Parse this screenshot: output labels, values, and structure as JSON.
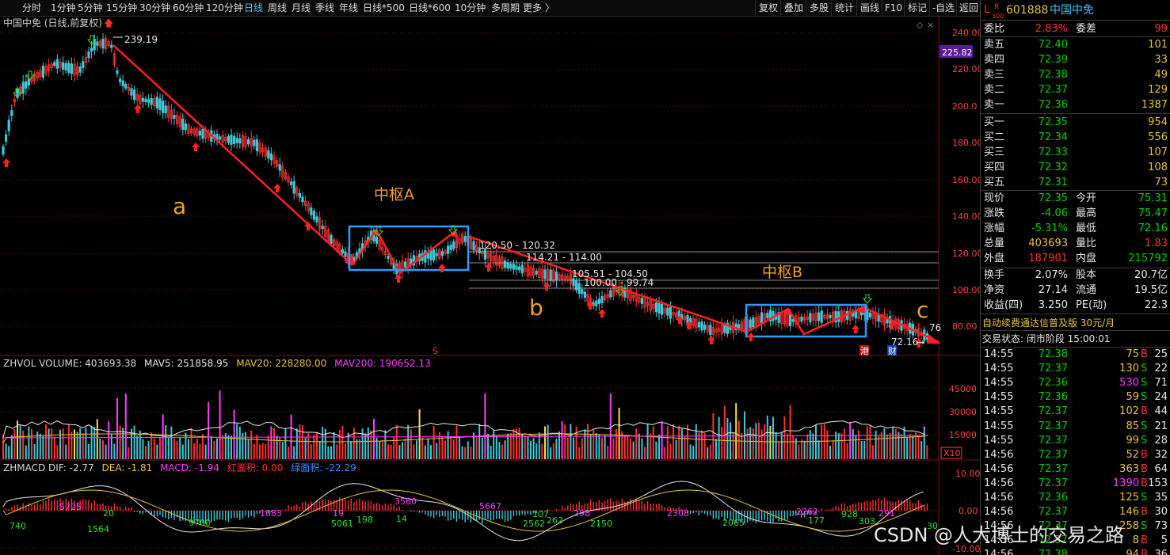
{
  "toolbar": {
    "periods": [
      "分时",
      "1分钟",
      "5分钟",
      "15分钟",
      "30分钟",
      "60分钟",
      "120分钟",
      "日线",
      "周线",
      "月线",
      "季线",
      "年线",
      "日线*500",
      "日线*600",
      "10分钟",
      "多周期",
      "更多 〉"
    ],
    "active": "日线",
    "right_buttons": [
      "复权",
      "叠加",
      "多股",
      "统计",
      "画线",
      "F10",
      "标记",
      "-自选",
      "返回"
    ]
  },
  "chart": {
    "title": "中国中免 (日线,前复权)",
    "price_axis": [
      "240.00",
      "220.00",
      "200.0",
      "180.00",
      "160.00",
      "140.00",
      "120.00",
      "100.00",
      "80.00"
    ],
    "current_price_label": "225.82",
    "high_label": "239.19",
    "low_label": "72.16",
    "last_label": "76",
    "annotations": {
      "a": "a",
      "b": "b",
      "c": "c",
      "zhongshu_a": "中枢A",
      "zhongshu_b": "中枢B"
    },
    "level_labels": [
      "120.50 - 120.32",
      "114.21 - 114.00",
      "105.51 - 104.50",
      "100.00 - 99.74"
    ],
    "markers": {
      "s": "S",
      "gang": "港",
      "cai": "财"
    },
    "volume": {
      "label": "ZHVOL VOLUME: 403693.38",
      "mav5": "MAV5: 251858.95",
      "mav20": "MAV20: 228280.00",
      "mav200": "MAV200: 190652.13",
      "axis": [
        "45000",
        "30000",
        "15000"
      ],
      "unit": "X10"
    },
    "macd": {
      "label": "ZHMACD DIF: -2.77",
      "dea": "DEA: -1.81",
      "macd": "MACD: -1.94",
      "red_area": "红面积: 0.00",
      "green_area": "绿面积: -22.29",
      "axis": [
        "10.00",
        "0.00",
        "-10.00"
      ],
      "bar_labels": [
        {
          "t": "740",
          "c": "g"
        },
        {
          "t": "5725",
          "c": "p"
        },
        {
          "t": "1564",
          "c": "g"
        },
        {
          "t": "20",
          "c": "g"
        },
        {
          "t": "9700",
          "c": "g"
        },
        {
          "t": "1083",
          "c": "p"
        },
        {
          "t": "19",
          "c": "p"
        },
        {
          "t": "5061",
          "c": "g"
        },
        {
          "t": "198",
          "c": "g"
        },
        {
          "t": "3560",
          "c": "p"
        },
        {
          "t": "14",
          "c": "g"
        },
        {
          "t": "5667",
          "c": "p"
        },
        {
          "t": "107",
          "c": "g"
        },
        {
          "t": "2562",
          "c": "g"
        },
        {
          "t": "262",
          "c": "g"
        },
        {
          "t": "298",
          "c": "p"
        },
        {
          "t": "2150",
          "c": "g"
        },
        {
          "t": "2308",
          "c": "p"
        },
        {
          "t": "2065",
          "c": "g"
        },
        {
          "t": "2262",
          "c": "p"
        },
        {
          "t": "177",
          "c": "g"
        },
        {
          "t": "928",
          "c": "g"
        },
        {
          "t": "303",
          "c": "g"
        },
        {
          "t": "291",
          "c": "p"
        },
        {
          "t": "30",
          "c": "g"
        }
      ]
    }
  },
  "side": {
    "header": {
      "code": "601888",
      "name": "中国中免",
      "badge_l": "L",
      "badge_r": "R",
      "badge_300": "300"
    },
    "weibi": {
      "label": "委比",
      "value": "2.83%",
      "label2": "委差",
      "value2": "99"
    },
    "asks": [
      {
        "label": "卖五",
        "price": "72.40",
        "vol": "101"
      },
      {
        "label": "卖四",
        "price": "72.39",
        "vol": "33"
      },
      {
        "label": "卖三",
        "price": "72.38",
        "vol": "49"
      },
      {
        "label": "卖二",
        "price": "72.37",
        "vol": "129"
      },
      {
        "label": "卖一",
        "price": "72.36",
        "vol": "1387"
      }
    ],
    "bids": [
      {
        "label": "买一",
        "price": "72.35",
        "vol": "954"
      },
      {
        "label": "买二",
        "price": "72.34",
        "vol": "556"
      },
      {
        "label": "买三",
        "price": "72.33",
        "vol": "107"
      },
      {
        "label": "买四",
        "price": "72.32",
        "vol": "108"
      },
      {
        "label": "买五",
        "price": "72.31",
        "vol": "73"
      }
    ],
    "quote": [
      {
        "l1": "现价",
        "v1": "72.35",
        "c1": "dn",
        "l2": "今开",
        "v2": "75.31",
        "c2": "dn"
      },
      {
        "l1": "涨跌",
        "v1": "-4.06",
        "c1": "dn",
        "l2": "最高",
        "v2": "75.47",
        "c2": "dn"
      },
      {
        "l1": "涨幅",
        "v1": "-5.31%",
        "c1": "dn",
        "l2": "最低",
        "v2": "72.16",
        "c2": "dn"
      },
      {
        "l1": "总量",
        "v1": "403693",
        "c1": "yl",
        "l2": "量比",
        "v2": "1.83",
        "c2": "up"
      },
      {
        "l1": "外盘",
        "v1": "187901",
        "c1": "up",
        "l2": "内盘",
        "v2": "215792",
        "c2": "dn"
      }
    ],
    "fund": [
      {
        "l1": "换手",
        "v1": "2.07%",
        "l2": "股本",
        "v2": "20.7亿"
      },
      {
        "l1": "净资",
        "v1": "27.14",
        "l2": "流通",
        "v2": "19.5亿"
      },
      {
        "l1": "收益(四)",
        "v1": "3.250",
        "l2": "PE(动)",
        "v2": "22.3"
      }
    ],
    "ad": "自动续费通达信普及版 30元/月",
    "status": "交易状态: 闭市阶段 15:00:01",
    "ticks": [
      {
        "t": "14:55",
        "p": "72.38",
        "v": "75",
        "s": "B",
        "n": "25"
      },
      {
        "t": "14:55",
        "p": "72.37",
        "v": "130",
        "s": "S",
        "n": "22"
      },
      {
        "t": "14:55",
        "p": "72.36",
        "v": "530",
        "s": "S",
        "n": "71"
      },
      {
        "t": "14:55",
        "p": "72.36",
        "v": "59",
        "s": "S",
        "n": "24"
      },
      {
        "t": "14:55",
        "p": "72.37",
        "v": "102",
        "s": "B",
        "n": "44"
      },
      {
        "t": "14:55",
        "p": "72.37",
        "v": "85",
        "s": "S",
        "n": "21"
      },
      {
        "t": "14:55",
        "p": "72.37",
        "v": "99",
        "s": "S",
        "n": "28"
      },
      {
        "t": "14:56",
        "p": "72.37",
        "v": "52",
        "s": "B",
        "n": "32"
      },
      {
        "t": "14:56",
        "p": "72.37",
        "v": "363",
        "s": "B",
        "n": "64"
      },
      {
        "t": "14:56",
        "p": "72.37",
        "v": "1390",
        "s": "B",
        "n": "153"
      },
      {
        "t": "14:56",
        "p": "72.36",
        "v": "125",
        "s": "S",
        "n": "35"
      },
      {
        "t": "14:56",
        "p": "72.37",
        "v": "146",
        "s": "B",
        "n": "30"
      },
      {
        "t": "14:56",
        "p": "72.37",
        "v": "258",
        "s": "S",
        "n": "73"
      },
      {
        "t": "14:56",
        "p": "72.37",
        "v": "8",
        "s": "B",
        "n": "5"
      },
      {
        "t": "14:56",
        "p": "72.38",
        "v": "94",
        "s": "B",
        "n": "36"
      }
    ]
  },
  "watermark": "CSDN @人大博士的交易之路",
  "colors": {
    "up": "#ff3030",
    "down": "#00d000",
    "trend": "#ff2020",
    "box": "#2e9bff",
    "yellow": "#e8c33a"
  }
}
